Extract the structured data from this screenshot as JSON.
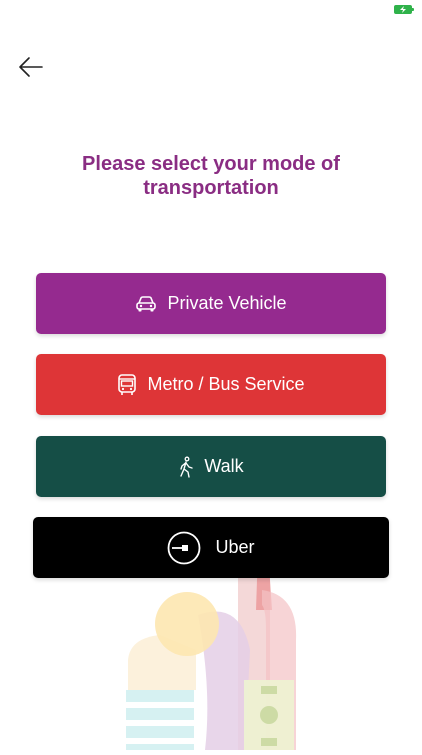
{
  "status_bar": {
    "battery_icon": "battery-charging-icon",
    "battery_color": "#2fb24a"
  },
  "header": {
    "back_icon": "arrow-left-icon"
  },
  "title": {
    "line1": "Please select your mode of",
    "line2": "transportation",
    "color": "#8a2d83"
  },
  "options": [
    {
      "label": "Private Vehicle",
      "icon": "car-icon",
      "color": "#952a8f"
    },
    {
      "label": "Metro / Bus Service",
      "icon": "bus-icon",
      "color": "#de3537"
    },
    {
      "label": "Walk",
      "icon": "walking-person-icon",
      "color": "#154e46"
    },
    {
      "label": "Uber",
      "icon": "uber-logo-icon",
      "color": "#000000"
    }
  ],
  "illustration": {
    "icon": "city-skyline-illustration"
  }
}
